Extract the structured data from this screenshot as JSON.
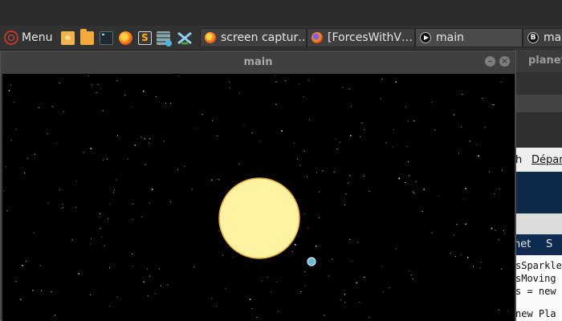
{
  "taskbar": {
    "menu_label": "Menu",
    "launchers": [
      "files-icon",
      "folder-icon",
      "terminal-icon",
      "firefox-icon",
      "s-app-icon",
      "grid-app-icon",
      "x-app-icon"
    ],
    "tasks": [
      {
        "label": "screen captur…",
        "icon": "firefox-icon"
      },
      {
        "label": "[ForcesWithV…",
        "icon": "firefox-icon"
      },
      {
        "label": "main",
        "icon": "play-icon"
      },
      {
        "label": "ma",
        "icon": "b-app-icon"
      }
    ]
  },
  "window": {
    "title": "main",
    "minimize_glyph": "–",
    "close_glyph": "×"
  },
  "background_window": {
    "title_fragment": "planet",
    "menu_fragment_a": "h",
    "menu_fragment_b": "Dépar",
    "tab_fragment_a": "net",
    "tab_fragment_b": "S",
    "code_lines": [
      "sSparkle",
      "sMoving",
      "s = new",
      "new Pla"
    ]
  },
  "scene": {
    "sun_color": "#fff3a3",
    "sun_outline": "#e5a53b",
    "planet_color": "#6db8d4",
    "planet_outline": "#d4ecf4",
    "star_color": "#ffffff",
    "background": "#000000"
  }
}
